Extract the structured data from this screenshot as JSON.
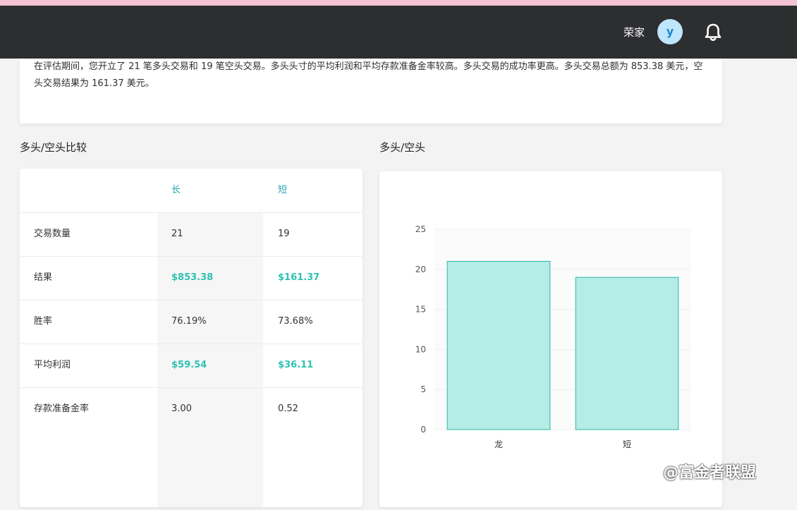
{
  "header": {
    "user_name": "荣家",
    "avatar_initial": "y"
  },
  "summary": {
    "text": "在评估期间，您开立了 21 笔多头交易和 19 笔空头交易。多头头寸的平均利润和平均存款准备金率较高。多头交易的成功率更高。多头交易总额为 853.38 美元，空头交易结果为 161.37 美元。"
  },
  "comparison": {
    "title": "多头/空头比较",
    "col_long": "长",
    "col_short": "短",
    "rows": [
      {
        "label": "交易数量",
        "long": "21",
        "short": "19"
      },
      {
        "label": "结果",
        "long": "$853.38",
        "short": "$161.37"
      },
      {
        "label": "胜率",
        "long": "76.19%",
        "short": "73.68%"
      },
      {
        "label": "平均利润",
        "long": "$59.54",
        "short": "$36.11"
      },
      {
        "label": "存款准备金率",
        "long": "3.00",
        "short": "0.52"
      }
    ]
  },
  "chart_title": "多头/空头",
  "chart_data": {
    "type": "bar",
    "categories": [
      "龙",
      "短"
    ],
    "values": [
      21,
      19
    ],
    "ylim": [
      0,
      25
    ],
    "yticks": [
      0,
      5,
      10,
      15,
      20,
      25
    ],
    "grid": true,
    "bar_fill": "#b5ece5",
    "bar_stroke": "#2bb5a8"
  },
  "colors": {
    "topbar": "#2d2e30",
    "accent_money": "#2cc2b0",
    "accent_header": "#2aa6b8"
  },
  "watermark": "@富金者联盟"
}
